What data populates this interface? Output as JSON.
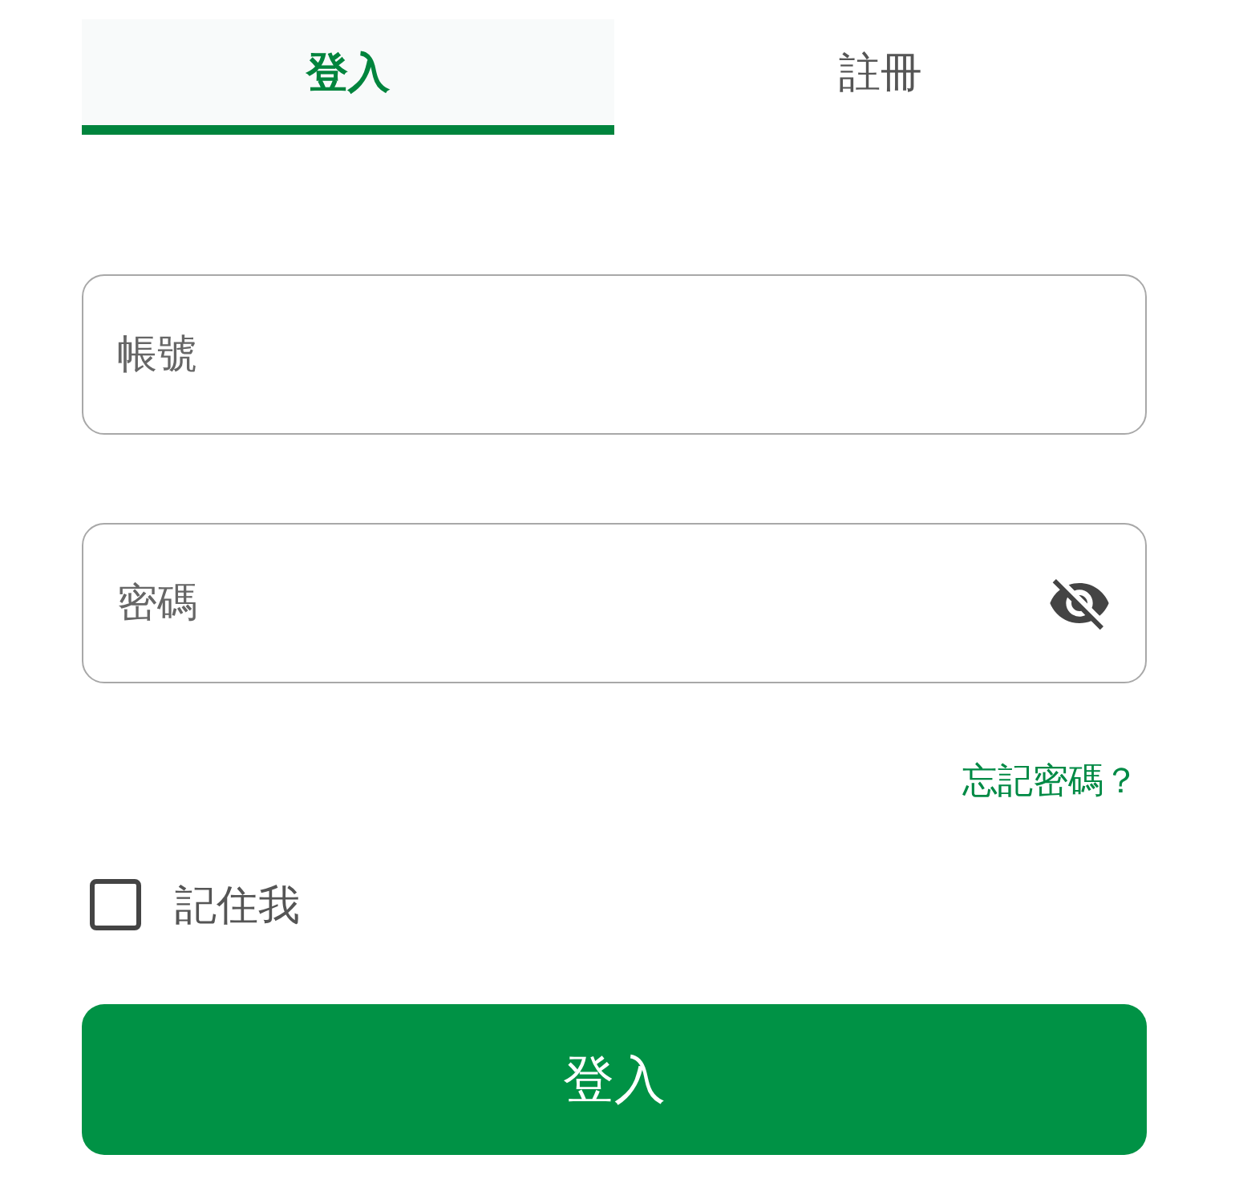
{
  "tabs": [
    {
      "label": "登入",
      "selected": true
    },
    {
      "label": "註冊",
      "selected": false
    }
  ],
  "fields": [
    {
      "kind": "text",
      "placeholder": "帳號"
    },
    {
      "kind": "password",
      "placeholder": "密碼"
    }
  ],
  "forgot_password_link": "忘記密碼？",
  "remember_me": {
    "label": "記住我",
    "checked": false
  },
  "submit_button": "登入"
}
